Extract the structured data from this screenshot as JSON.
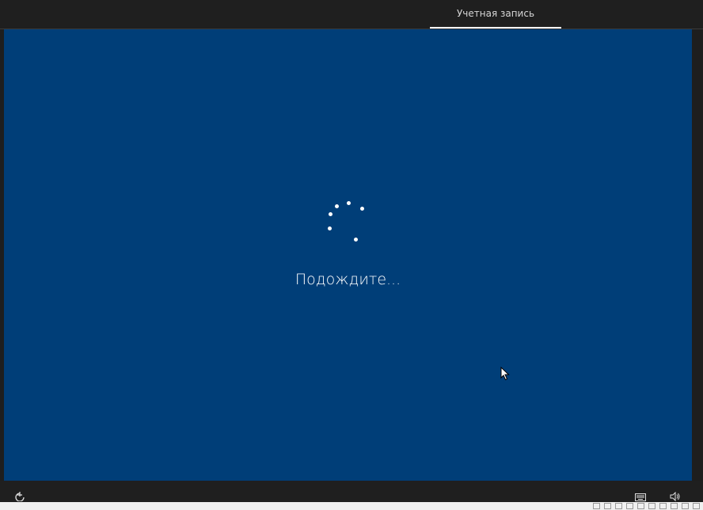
{
  "topbar": {
    "tab_account": "Учетная запись"
  },
  "main": {
    "status_text": "Подождите..."
  },
  "icons": {
    "ease_of_access": "ease-of-access-icon",
    "keyboard": "keyboard-icon",
    "volume": "volume-icon",
    "cursor": "mouse-cursor-icon"
  },
  "colors": {
    "background": "#003e78",
    "bars": "#1f1f1f",
    "accent_underline": "#ffffff",
    "text": "#ffffff"
  }
}
